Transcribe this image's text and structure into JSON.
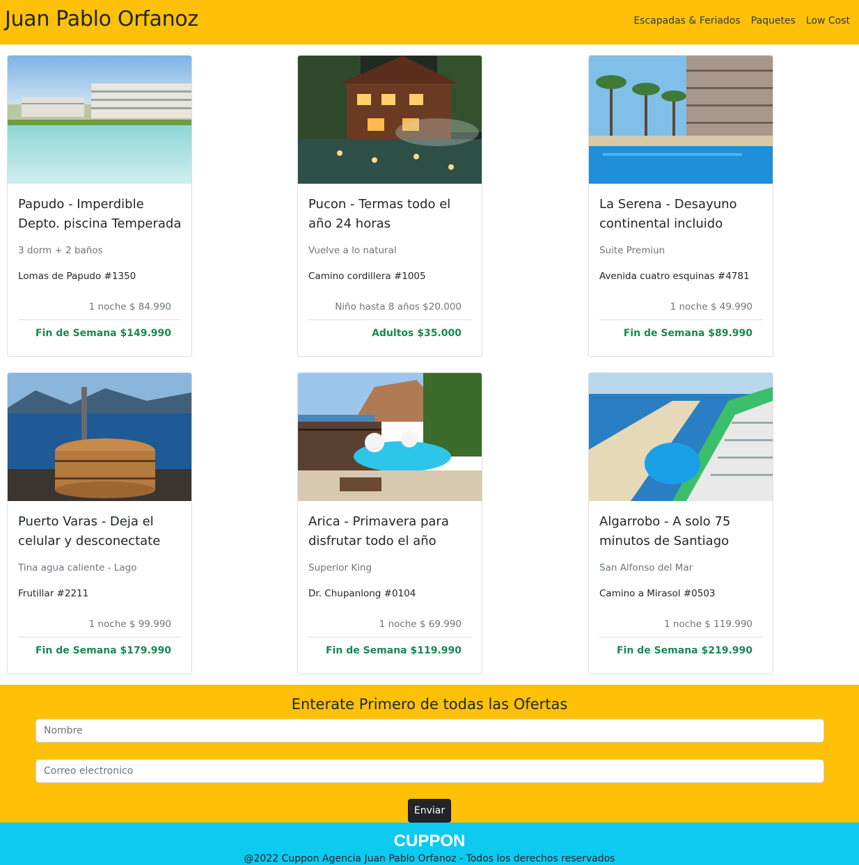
{
  "navbar": {
    "brand": "Juan Pablo Orfanoz",
    "links": [
      "Escapadas & Feriados",
      "Paquetes",
      "Low Cost"
    ]
  },
  "cards": [
    {
      "image": "beach-apartment-pool-photo",
      "title": "Papudo - Imperdible Depto. piscina Temperada",
      "subtitle": "3 dorm + 2 baños",
      "address": "Lomas de Papudo #1350",
      "price_small": "1 noche $ 84.990",
      "price_main": "Fin de Semana $149.990"
    },
    {
      "image": "hot-springs-lodge-photo",
      "title": "Pucon - Termas todo el año 24 horas",
      "subtitle": "Vuelve a lo natural",
      "address": "Camino cordillera #1005",
      "price_small": "Niño hasta 8 años $20.000",
      "price_main": "Adultos $35.000"
    },
    {
      "image": "resort-pool-palms-photo",
      "title": "La Serena - Desayuno continental incluido",
      "subtitle": "Suite Premiun",
      "address": "Avenida cuatro esquinas #4781",
      "price_small": "1 noche $ 49.990",
      "price_main": "Fin de Semana $89.990"
    },
    {
      "image": "lake-hot-tub-photo",
      "title": "Puerto Varas - Deja el celular y desconectate",
      "subtitle": "Tina agua caliente - Lago",
      "address": "Frutillar #2211",
      "price_small": "1 noche $ 99.990",
      "price_main": "Fin de Semana $179.990"
    },
    {
      "image": "arica-pool-cliff-photo",
      "title": "Arica - Primavera para disfrutar todo el año",
      "subtitle": "Superior King",
      "address": "Dr. Chupanlong #0104",
      "price_small": "1 noche $ 69.990",
      "price_main": "Fin de Semana $119.990"
    },
    {
      "image": "algarrobo-lagoon-resort-photo",
      "title": "Algarrobo - A solo 75 minutos de Santiago",
      "subtitle": "San Alfonso del Mar",
      "address": "Camino a Mirasol #0503",
      "price_small": "1 noche $ 119.990",
      "price_main": "Fin de Semana $219.990"
    }
  ],
  "subscribe": {
    "title": "Enterate Primero de todas las Ofertas",
    "name_placeholder": "Nombre",
    "email_placeholder": "Correo electronico",
    "button": "Enviar"
  },
  "footer": {
    "logo": "CUPPON",
    "copyright": "@2022 Cuppon Agencia Juan Pablo Orfanoz - Todos los derechos reservados"
  },
  "colors": {
    "accent_yellow": "#ffc107",
    "footer_cyan": "#0dcaf0",
    "price_green": "#198754"
  }
}
